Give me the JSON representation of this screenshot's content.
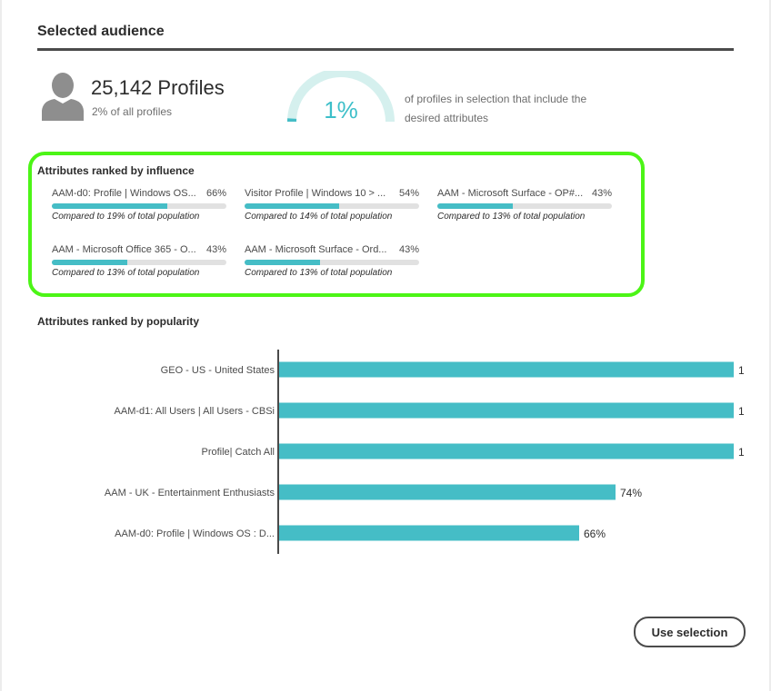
{
  "header": {
    "title": "Selected audience"
  },
  "summary": {
    "profiles_count": "25,142 Profiles",
    "profiles_share": "2% of all profiles",
    "gauge_value": "1%",
    "gauge_fraction": 0.01,
    "gauge_description": "of profiles in selection that include the desired attributes"
  },
  "influence": {
    "heading": "Attributes ranked by influence",
    "items": [
      {
        "label": "AAM-d0: Profile | Windows OS...",
        "percent": "66%",
        "fill": 0.66,
        "compare": "Compared to 19% of total population"
      },
      {
        "label": "Visitor Profile | Windows 10 > ...",
        "percent": "54%",
        "fill": 0.54,
        "compare": "Compared to 14% of total population"
      },
      {
        "label": "AAM - Microsoft Surface - OP#...",
        "percent": "43%",
        "fill": 0.43,
        "compare": "Compared to 13% of total population"
      },
      {
        "label": "AAM - Microsoft Office 365 - O...",
        "percent": "43%",
        "fill": 0.43,
        "compare": "Compared to 13% of total population"
      },
      {
        "label": "AAM - Microsoft Surface - Ord...",
        "percent": "43%",
        "fill": 0.43,
        "compare": "Compared to 13% of total population"
      }
    ]
  },
  "popularity": {
    "heading": "Attributes ranked by popularity"
  },
  "chart_data": {
    "type": "bar",
    "orientation": "horizontal",
    "categories": [
      "GEO - US - United States",
      "AAM-d1: All Users | All Users - CBSi",
      "Profile| Catch All",
      "AAM - UK - Entertainment Enthusiasts",
      "AAM-d0: Profile | Windows OS : D..."
    ],
    "values": [
      1.0,
      1.0,
      1.0,
      0.74,
      0.66
    ],
    "data_labels": [
      "1",
      "1",
      "1",
      "74%",
      "66%"
    ],
    "xlim": [
      0,
      1
    ],
    "bar_color": "#45bdc6"
  },
  "actions": {
    "use_selection": "Use selection"
  },
  "colors": {
    "accent": "#45bdc6",
    "gauge_track": "#d5f0ee",
    "highlight_border": "#4cf516"
  }
}
